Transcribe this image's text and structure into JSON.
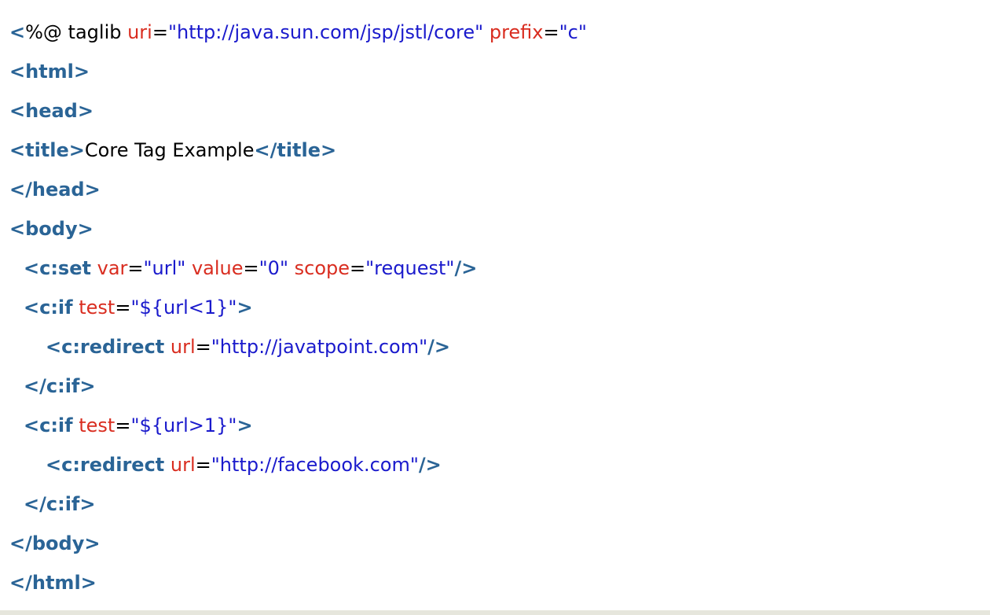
{
  "code": {
    "lines": [
      {
        "indent": 0,
        "tokens": [
          {
            "t": "tag",
            "v": "<"
          },
          {
            "t": "text",
            "v": "%@ taglib "
          },
          {
            "t": "attr",
            "v": "uri"
          },
          {
            "t": "text",
            "v": "="
          },
          {
            "t": "str",
            "v": "\"http://java.sun.com/jsp/jstl/core\""
          },
          {
            "t": "text",
            "v": " "
          },
          {
            "t": "attr",
            "v": "prefix"
          },
          {
            "t": "text",
            "v": "="
          },
          {
            "t": "str",
            "v": "\"c\""
          }
        ]
      },
      {
        "indent": 0,
        "tokens": [
          {
            "t": "tag",
            "v": "<html>"
          }
        ]
      },
      {
        "indent": 0,
        "tokens": [
          {
            "t": "tag",
            "v": "<head>"
          }
        ]
      },
      {
        "indent": 0,
        "tokens": [
          {
            "t": "tag",
            "v": "<title>"
          },
          {
            "t": "text",
            "v": "Core Tag Example"
          },
          {
            "t": "tag",
            "v": "</title>"
          }
        ]
      },
      {
        "indent": 0,
        "tokens": [
          {
            "t": "tag",
            "v": "</head>"
          }
        ]
      },
      {
        "indent": 0,
        "tokens": [
          {
            "t": "tag",
            "v": "<body>"
          }
        ]
      },
      {
        "indent": 1,
        "tokens": [
          {
            "t": "tag",
            "v": "<c:set"
          },
          {
            "t": "text",
            "v": " "
          },
          {
            "t": "attr",
            "v": "var"
          },
          {
            "t": "text",
            "v": "="
          },
          {
            "t": "str",
            "v": "\"url\""
          },
          {
            "t": "text",
            "v": " "
          },
          {
            "t": "attr",
            "v": "value"
          },
          {
            "t": "text",
            "v": "="
          },
          {
            "t": "str",
            "v": "\"0\""
          },
          {
            "t": "text",
            "v": " "
          },
          {
            "t": "attr",
            "v": "scope"
          },
          {
            "t": "text",
            "v": "="
          },
          {
            "t": "str",
            "v": "\"request\""
          },
          {
            "t": "tag",
            "v": "/>"
          }
        ]
      },
      {
        "indent": 1,
        "tokens": [
          {
            "t": "tag",
            "v": "<c:if"
          },
          {
            "t": "text",
            "v": " "
          },
          {
            "t": "attr",
            "v": "test"
          },
          {
            "t": "text",
            "v": "="
          },
          {
            "t": "str",
            "v": "\"${url<1}\""
          },
          {
            "t": "tag",
            "v": ">"
          }
        ]
      },
      {
        "indent": 2,
        "tokens": [
          {
            "t": "tag",
            "v": "<c:redirect"
          },
          {
            "t": "text",
            "v": " "
          },
          {
            "t": "attr",
            "v": "url"
          },
          {
            "t": "text",
            "v": "="
          },
          {
            "t": "str",
            "v": "\"http://javatpoint.com\""
          },
          {
            "t": "tag",
            "v": "/>"
          }
        ]
      },
      {
        "indent": 1,
        "tokens": [
          {
            "t": "tag",
            "v": "</c:if>"
          }
        ]
      },
      {
        "indent": 1,
        "tokens": [
          {
            "t": "tag",
            "v": "<c:if"
          },
          {
            "t": "text",
            "v": " "
          },
          {
            "t": "attr",
            "v": "test"
          },
          {
            "t": "text",
            "v": "="
          },
          {
            "t": "str",
            "v": "\"${url>1}\""
          },
          {
            "t": "tag",
            "v": ">"
          }
        ]
      },
      {
        "indent": 2,
        "tokens": [
          {
            "t": "tag",
            "v": "<c:redirect"
          },
          {
            "t": "text",
            "v": " "
          },
          {
            "t": "attr",
            "v": "url"
          },
          {
            "t": "text",
            "v": "="
          },
          {
            "t": "str",
            "v": "\"http://facebook.com\""
          },
          {
            "t": "tag",
            "v": "/>"
          }
        ]
      },
      {
        "indent": 1,
        "tokens": [
          {
            "t": "tag",
            "v": "</c:if>"
          }
        ]
      },
      {
        "indent": 0,
        "tokens": [
          {
            "t": "tag",
            "v": "</body>"
          }
        ]
      },
      {
        "indent": 0,
        "tokens": [
          {
            "t": "tag",
            "v": "</html>"
          }
        ]
      }
    ]
  },
  "colors": {
    "tag": "#2a6496",
    "attribute": "#d92d20",
    "string": "#1a1acc",
    "text": "#000000",
    "background": "#ffffff"
  }
}
